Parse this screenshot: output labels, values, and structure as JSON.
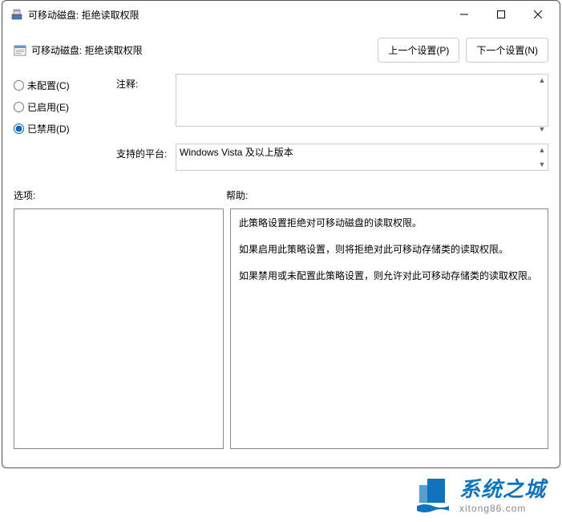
{
  "window": {
    "title": "可移动磁盘: 拒绝读取权限"
  },
  "header": {
    "title": "可移动磁盘: 拒绝读取权限",
    "prev_button": "上一个设置(P)",
    "next_button": "下一个设置(N)"
  },
  "radios": {
    "not_configured": "未配置(C)",
    "enabled": "已启用(E)",
    "disabled": "已禁用(D)"
  },
  "labels": {
    "comment": "注释:",
    "supported": "支持的平台:",
    "options": "选项:",
    "help": "帮助:"
  },
  "supported_text": "Windows Vista 及以上版本",
  "help_text": {
    "p1": "此策略设置拒绝对可移动磁盘的读取权限。",
    "p2": "如果启用此策略设置，则将拒绝对此可移动存储类的读取权限。",
    "p3": "如果禁用或未配置此策略设置，则允许对此可移动存储类的读取权限。"
  },
  "watermark": {
    "cn": "系统之城",
    "url": "xitong86.com"
  }
}
